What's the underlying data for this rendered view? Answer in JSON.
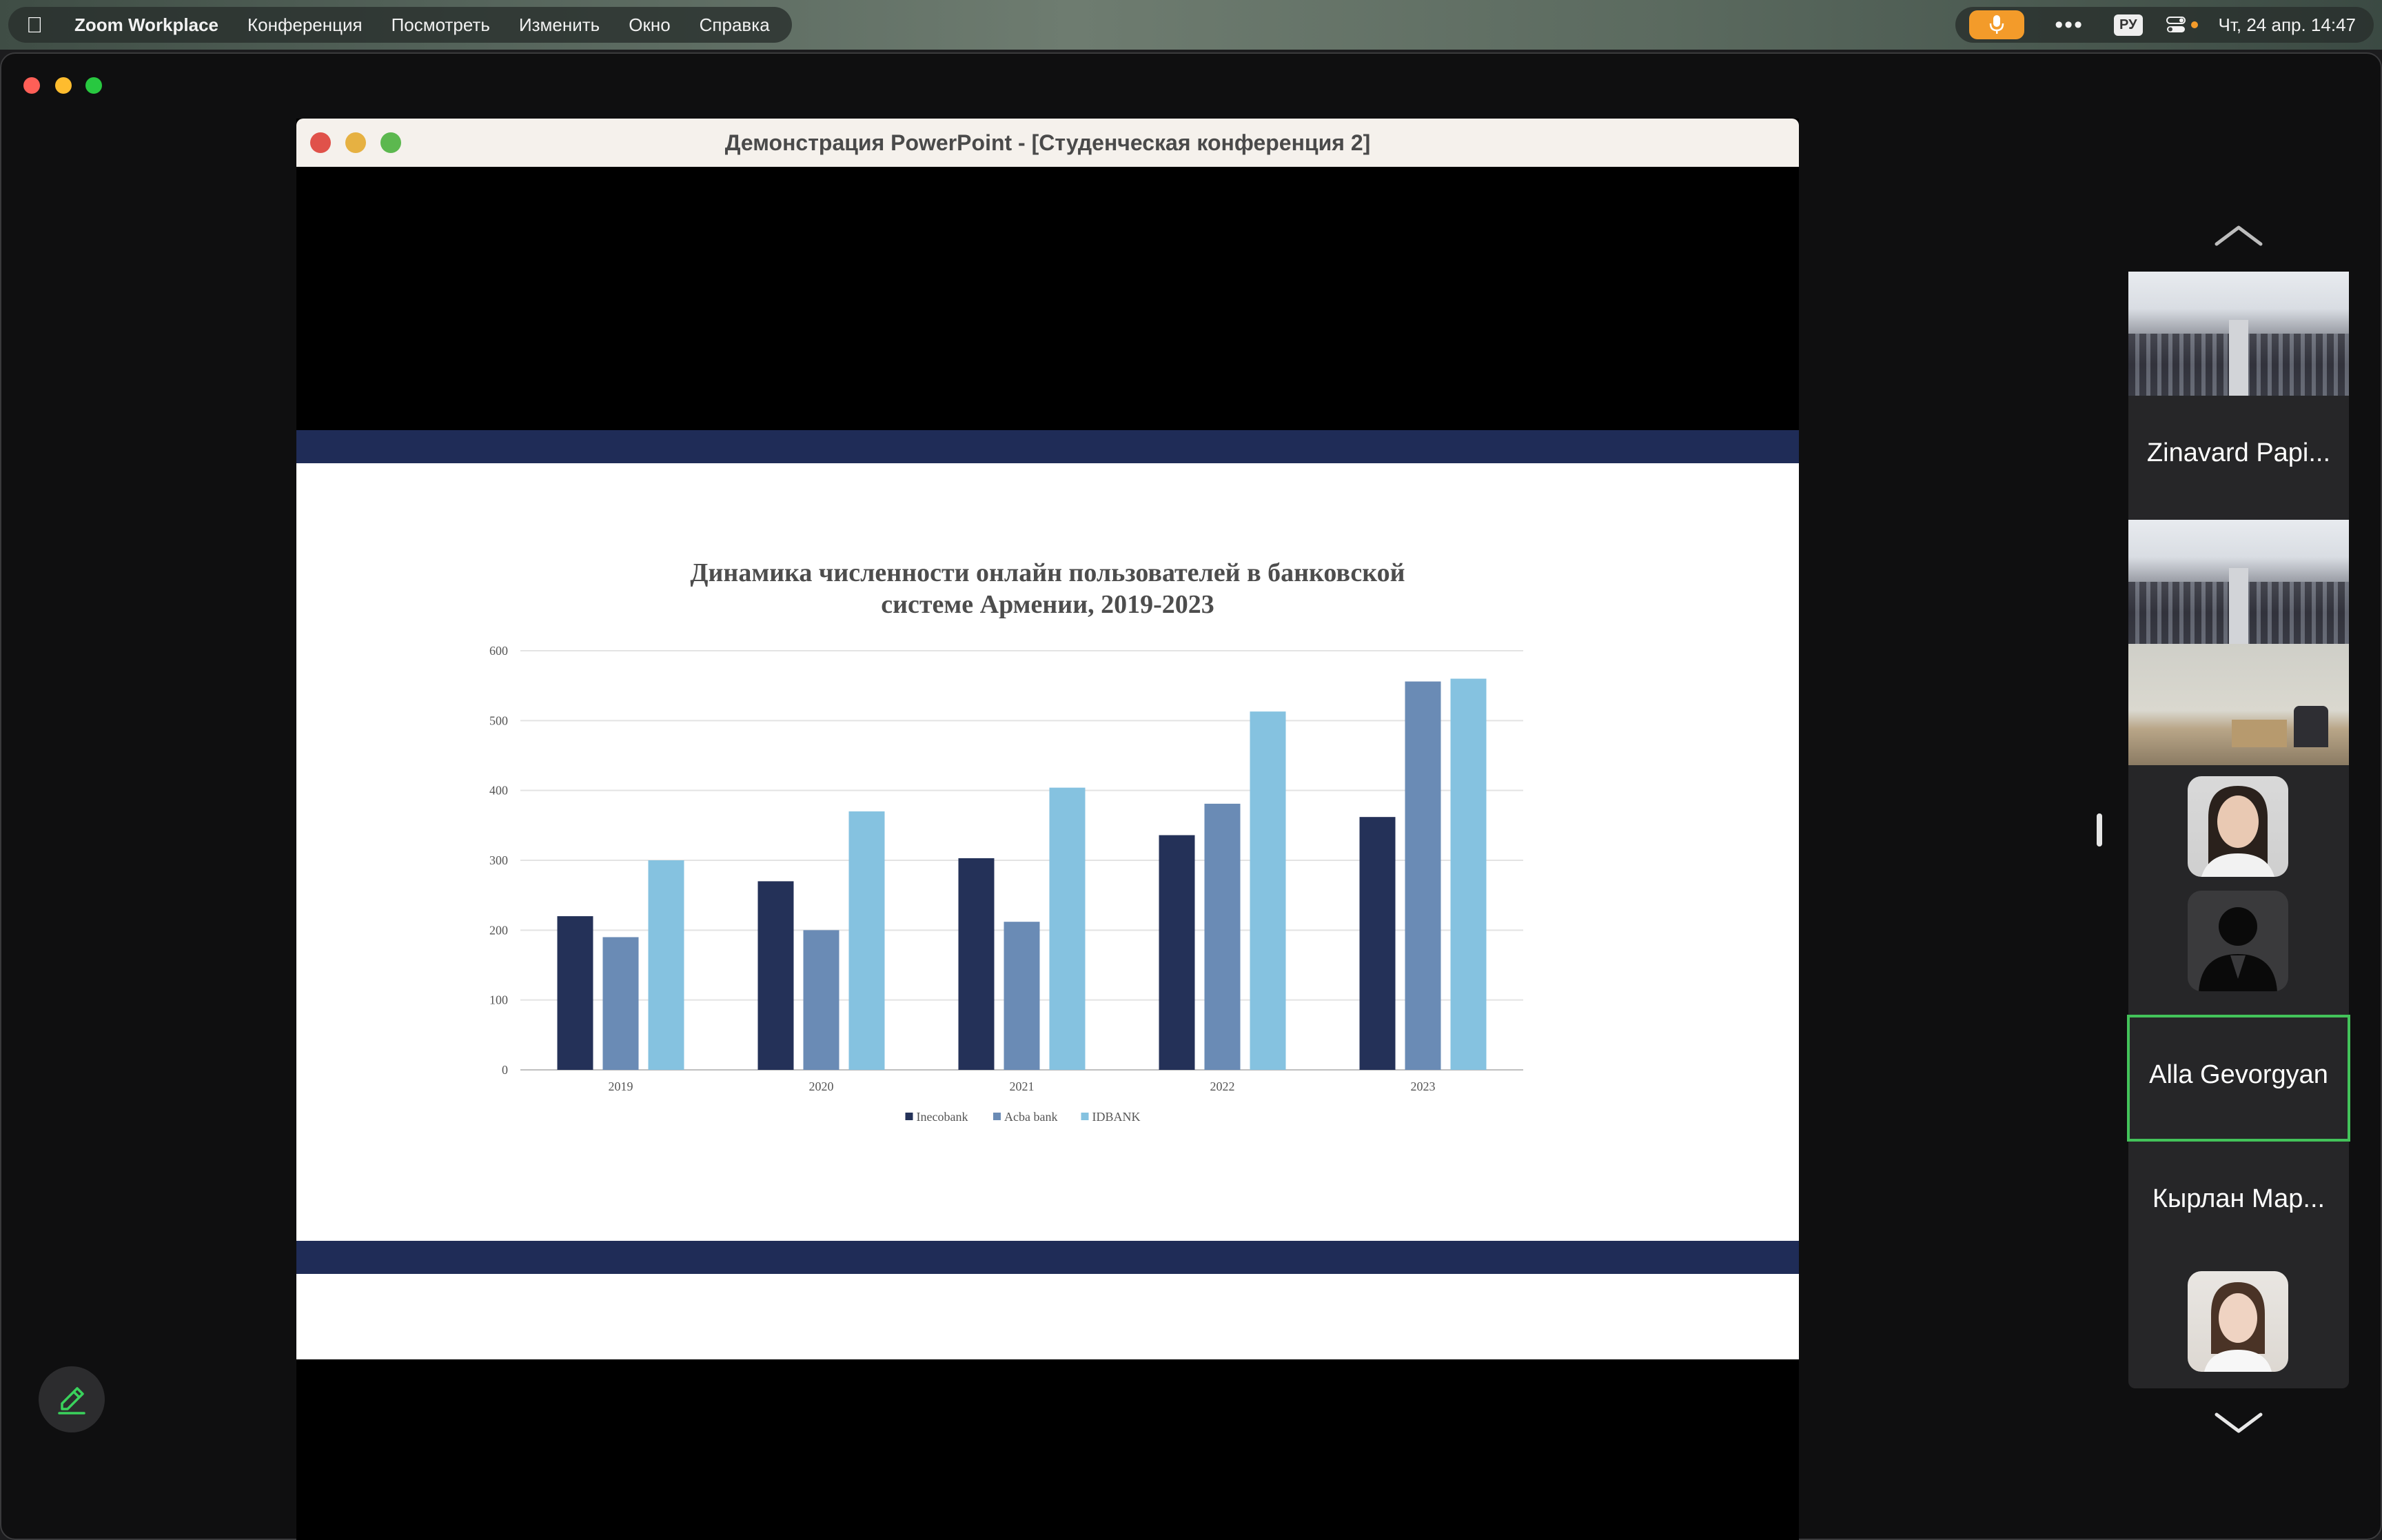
{
  "menubar": {
    "app_name": "Zoom Workplace",
    "menus": [
      "Конференция",
      "Посмотреть",
      "Изменить",
      "Окно",
      "Справка"
    ],
    "lang": "РУ",
    "clock": "Чт, 24 апр.  14:47"
  },
  "shared_window": {
    "title": "Демонстрация PowerPoint - [Студенческая конференция 2]"
  },
  "chart_data": {
    "type": "bar",
    "title_line1": "Динамика численности онлайн пользователей в банковской",
    "title_line2": "системе Армении, 2019-2023",
    "categories": [
      "2019",
      "2020",
      "2021",
      "2022",
      "2023"
    ],
    "series": [
      {
        "name": "Inecobank",
        "values": [
          220,
          270,
          303,
          336,
          362
        ],
        "color": "#243158"
      },
      {
        "name": "Acba bank",
        "values": [
          190,
          200,
          212,
          381,
          556
        ],
        "color": "#6a8bb5"
      },
      {
        "name": "IDBANK",
        "values": [
          300,
          370,
          404,
          513,
          560
        ],
        "color": "#85c2e0"
      }
    ],
    "yticks": [
      "0",
      "100",
      "200",
      "300",
      "400",
      "500",
      "600"
    ],
    "ylim": [
      0,
      600
    ],
    "grid": true,
    "legend": "bottom"
  },
  "participants": [
    {
      "name": "Zinavard Papi..."
    },
    {
      "name": "Alla Gevorgyan"
    },
    {
      "name": "Кырлан Мар..."
    }
  ],
  "colors": {
    "accent_orange": "#f39b2a",
    "active_speaker": "#43c35a",
    "slide_band": "#1f2c57"
  }
}
